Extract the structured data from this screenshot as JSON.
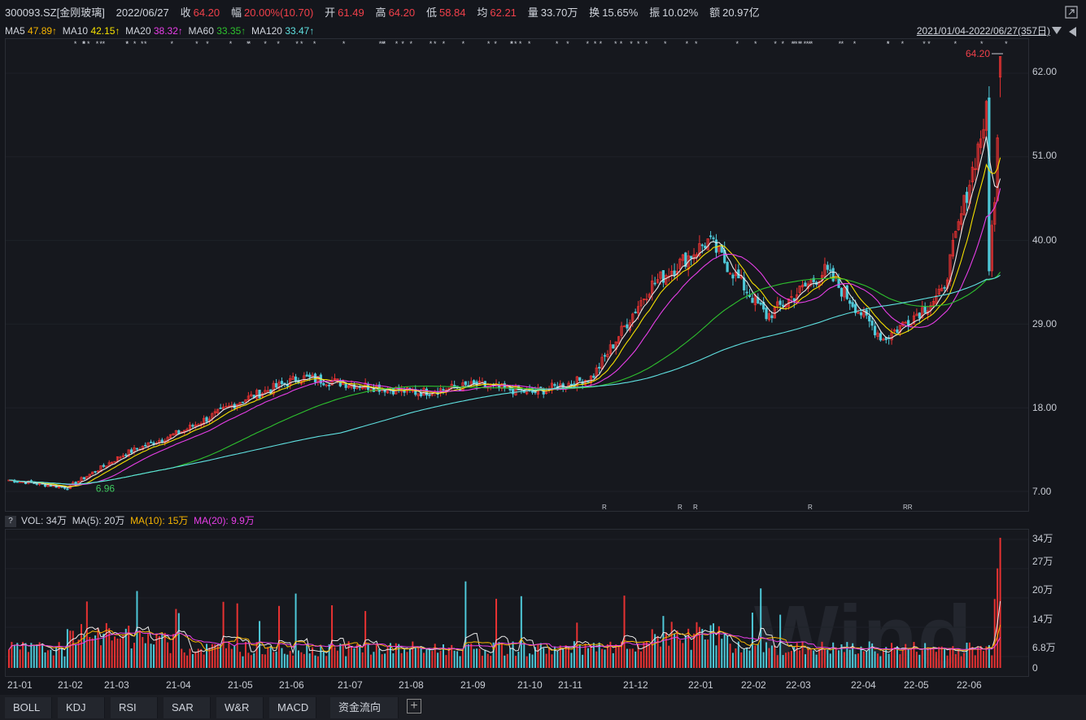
{
  "header": {
    "code": "300093.SZ[金刚玻璃]",
    "date": "2022/06/27",
    "close_label": "收",
    "close": "64.20",
    "range_label": "幅",
    "range": "20.00%(10.70)",
    "open_label": "开",
    "open": "61.49",
    "high_label": "高",
    "high": "64.20",
    "low_label": "低",
    "low": "58.84",
    "avg_label": "均",
    "avg": "62.21",
    "volume_label": "量",
    "volume": "33.70万",
    "turnover_label": "换",
    "turnover": "15.65%",
    "amplitude_label": "振",
    "amplitude": "10.02%",
    "amount_label": "额",
    "amount": "20.97亿"
  },
  "ma_bar": {
    "ma5": "MA5",
    "ma5_val": "47.89↑",
    "ma10": "MA10",
    "ma10_val": "42.15↑",
    "ma20": "MA20",
    "ma20_val": "38.32↑",
    "ma60": "MA60",
    "ma60_val": "33.35↑",
    "ma120": "MA120",
    "ma120_val": "33.47↑",
    "date_range": "2021/01/04-2022/06/27(357日)"
  },
  "colors": {
    "ma5": "#e8e8e8",
    "ma10": "#f5b400",
    "ma20": "#e83ee8",
    "ma60": "#2ec12e",
    "ma120": "#5fe0e0",
    "up": "#e83232",
    "down": "#4ec8d8",
    "min_label": "#3ec85e",
    "price_label": "#f0404a"
  },
  "price_axis": [
    "62.00",
    "51.00",
    "40.00",
    "29.00",
    "18.00",
    "7.00"
  ],
  "price_markers": {
    "last_price": "64.20",
    "min_price": "6.96"
  },
  "volume": {
    "help": "?",
    "title": "VOL: 34万",
    "ma5": "MA(5): 20万",
    "ma10": "MA(10): 15万",
    "ma20": "MA(20): 9.9万",
    "axis": [
      "34万",
      "27万",
      "20万",
      "14万",
      "6.8万",
      "0"
    ]
  },
  "x_axis": [
    "21-01",
    "21-02",
    "21-03",
    "21-04",
    "21-05",
    "21-06",
    "21-07",
    "21-08",
    "21-09",
    "21-10",
    "21-11",
    "21-12",
    "22-01",
    "22-02",
    "22-03",
    "22-04",
    "22-05",
    "22-06"
  ],
  "r_markers": [
    "R",
    "R",
    "R",
    "R",
    "RR"
  ],
  "watermark": "Wind",
  "tabs": [
    "BOLL",
    "KDJ",
    "RSI",
    "SAR",
    "W&R",
    "MACD",
    "资金流向"
  ],
  "chart_data": {
    "type": "candlestick",
    "price_range": [
      7.0,
      62.0
    ],
    "ma_series": [
      {
        "name": "MA5",
        "values_note": "47.89"
      },
      {
        "name": "MA10",
        "values_note": "42.15"
      },
      {
        "name": "MA20",
        "values_note": "38.32"
      },
      {
        "name": "MA60",
        "values_note": "33.35"
      },
      {
        "name": "MA120",
        "values_note": "33.47"
      }
    ],
    "monthly_close_estimate": {
      "x": [
        "21-01",
        "21-02",
        "21-03",
        "21-04",
        "21-05",
        "21-06",
        "21-07",
        "21-08",
        "21-09",
        "21-10",
        "21-11",
        "21-12",
        "22-01",
        "22-02",
        "22-03",
        "22-04",
        "22-05",
        "22-06"
      ],
      "y": [
        8.5,
        7.5,
        12,
        15,
        19,
        22,
        21,
        20,
        21,
        20,
        22,
        34,
        40,
        30,
        36,
        27,
        33,
        64.2
      ]
    }
  }
}
